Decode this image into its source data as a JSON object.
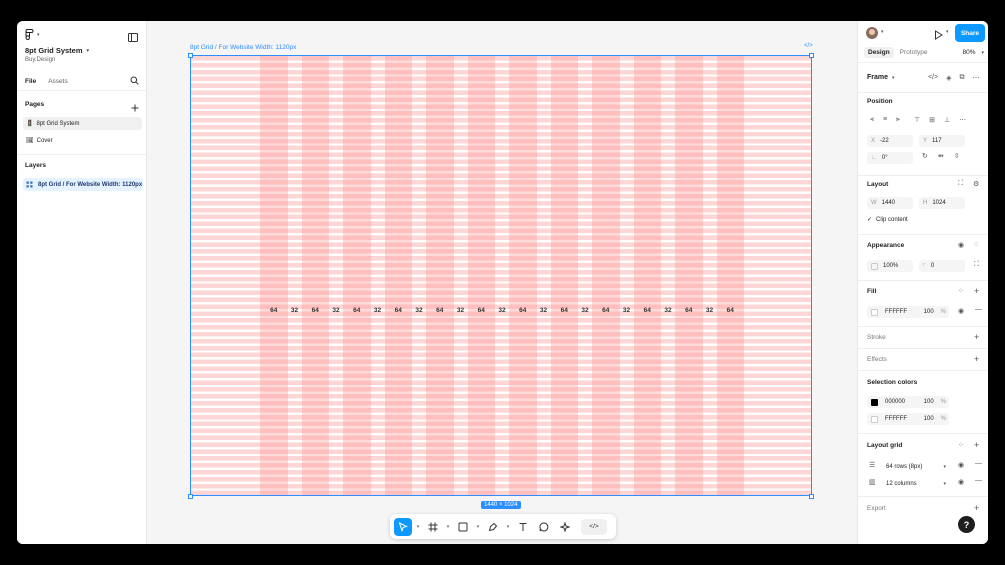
{
  "app": {
    "file_name": "8pt Grid System",
    "team": "Buy.Design"
  },
  "left_panel": {
    "tab_file": "File",
    "tab_assets": "Assets",
    "pages_heading": "Pages",
    "pages": [
      {
        "icon": "🚦",
        "label": "8pt Grid System"
      },
      {
        "icon": "🖼",
        "label": "Cover"
      }
    ],
    "layers_heading": "Layers",
    "layer_label": "8pt Grid / For Website Width: 1120px"
  },
  "canvas": {
    "frame_label": "8pt Grid / For Website Width: 1120px",
    "size_badge": "1440 × 1024",
    "column_labels": [
      "64",
      "32",
      "64",
      "32",
      "64",
      "32",
      "64",
      "32",
      "64",
      "32",
      "64",
      "32",
      "64",
      "32",
      "64",
      "32",
      "64",
      "32",
      "64",
      "32",
      "64",
      "32",
      "64"
    ],
    "colors": {
      "row_stripe": "#ffd6d6",
      "selection": "#2d8fff"
    }
  },
  "toolbar": {
    "tools": [
      "move-tool",
      "frame-tool",
      "rectangle-tool",
      "pen-tool",
      "text-tool",
      "comment-tool",
      "actions-tool",
      "dev-mode-tool"
    ]
  },
  "right_panel": {
    "share_label": "Share",
    "tab_design": "Design",
    "tab_prototype": "Prototype",
    "zoom": "80%",
    "frame_label": "Frame",
    "position": {
      "heading": "Position",
      "x_label": "X",
      "x_value": "-22",
      "y_label": "Y",
      "y_value": "117",
      "rotation_value": "0°"
    },
    "layout": {
      "heading": "Layout",
      "w_label": "W",
      "w_value": "1440",
      "h_label": "H",
      "h_value": "1024",
      "clip_content": "Clip content"
    },
    "appearance": {
      "heading": "Appearance",
      "opacity": "100%",
      "radius": "0"
    },
    "fill": {
      "heading": "Fill",
      "hex": "FFFFFF",
      "opacity": "100",
      "percent": "%"
    },
    "stroke_heading": "Stroke",
    "effects_heading": "Effects",
    "selection_colors": {
      "heading": "Selection colors",
      "items": [
        {
          "hex": "000000",
          "opacity": "100",
          "percent": "%",
          "color": "#000000"
        },
        {
          "hex": "FFFFFF",
          "opacity": "100",
          "percent": "%",
          "color": "#FFFFFF"
        }
      ]
    },
    "layout_grid": {
      "heading": "Layout grid",
      "rows": "64 rows (8px)",
      "columns": "12 columns"
    },
    "export_heading": "Export",
    "help": "?"
  }
}
